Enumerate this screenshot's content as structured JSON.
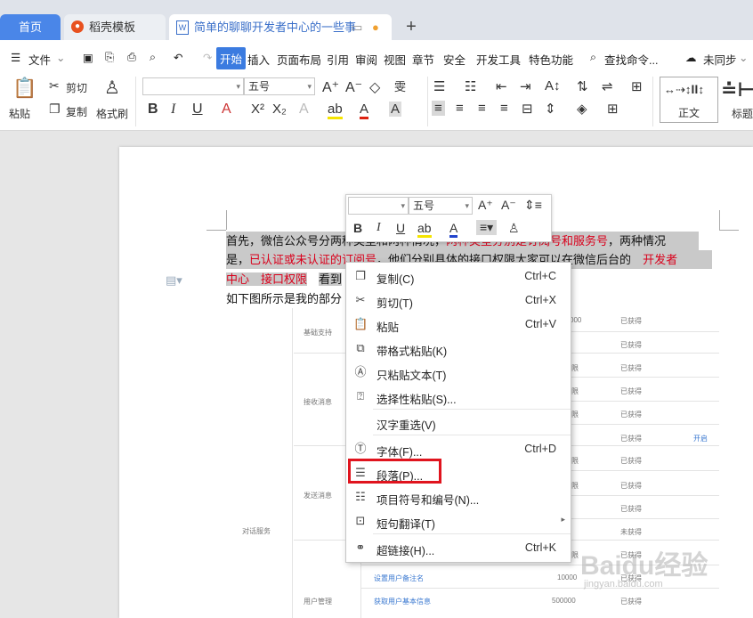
{
  "tabs": {
    "home": "首页",
    "template": "稻壳模板",
    "document": "简单的聊聊开发者中心的一些事"
  },
  "menubar": {
    "file": "文件",
    "items": [
      "开始",
      "插入",
      "页面布局",
      "引用",
      "审阅",
      "视图",
      "章节",
      "安全",
      "开发工具",
      "特色功能"
    ],
    "search": "查找命令...",
    "sync": "未同步"
  },
  "ribbon": {
    "paste": "粘贴",
    "cut": "剪切",
    "copy": "复制",
    "format_painter": "格式刷",
    "font_size": "五号",
    "style_normal": "正文",
    "style_heading": "标题"
  },
  "document": {
    "line1_a": "首先，微信公众号分两种类型和两种情况，",
    "line1_b": "两种类型分别是订阅号和服务号",
    "line1_c": "，两种情况",
    "line2_a": "是，",
    "line2_b": "已认证或未认证的订阅号",
    "line2_c": "，他们分别具体的接口权限大家可以在微信后台的",
    "line2_d": "开发者",
    "line3_a": "中心　接口权限",
    "line3_b": "看到",
    "line4": "如下图所示是我的部分"
  },
  "table": {
    "categories": [
      "基础支持",
      "接收消息",
      "发送消息",
      "对话服务",
      "用户管理"
    ],
    "statuses": [
      "已获得",
      "已获得",
      "已获得",
      "已获得",
      "已获得",
      "已获得",
      "已获得",
      "已获得",
      "已获得",
      "未获得",
      "已获得",
      "已获得",
      "已获得"
    ],
    "open_link": "开启",
    "row1_value": "000",
    "row_last_a": "设置用户备注名",
    "row_last_a_value": "10000",
    "row_last_b": "获取用户基本信息",
    "row_last_b_value": "500000",
    "limit_char": "限"
  },
  "mini_toolbar": {
    "font_size": "五号"
  },
  "context_menu": [
    {
      "label": "复制(C)",
      "shortcut": "Ctrl+C",
      "icon": "copy-icon"
    },
    {
      "label": "剪切(T)",
      "shortcut": "Ctrl+X",
      "icon": "scissors-icon"
    },
    {
      "label": "粘贴",
      "shortcut": "Ctrl+V",
      "icon": "paste-icon"
    },
    {
      "label": "带格式粘贴(K)",
      "shortcut": "",
      "icon": "paste-format-icon"
    },
    {
      "label": "只粘贴文本(T)",
      "shortcut": "",
      "icon": "paste-text-icon"
    },
    {
      "label": "选择性粘贴(S)...",
      "shortcut": "",
      "icon": "paste-special-icon"
    },
    {
      "label": "汉字重选(V)",
      "shortcut": "",
      "icon": ""
    },
    {
      "label": "字体(F)...",
      "shortcut": "Ctrl+D",
      "icon": "font-icon"
    },
    {
      "label": "段落(P)...",
      "shortcut": "",
      "icon": "paragraph-icon"
    },
    {
      "label": "项目符号和编号(N)...",
      "shortcut": "",
      "icon": "bullets-icon"
    },
    {
      "label": "短句翻译(T)",
      "shortcut": "",
      "icon": "translate-icon"
    },
    {
      "label": "超链接(H)...",
      "shortcut": "Ctrl+K",
      "icon": "link-icon"
    }
  ],
  "watermark": {
    "main": "Baidu经验",
    "sub": "jingyan.baidu.com"
  },
  "colors": {
    "accent": "#3b7be0",
    "red_text": "#d9001b",
    "highlight_box": "#e0141e"
  }
}
